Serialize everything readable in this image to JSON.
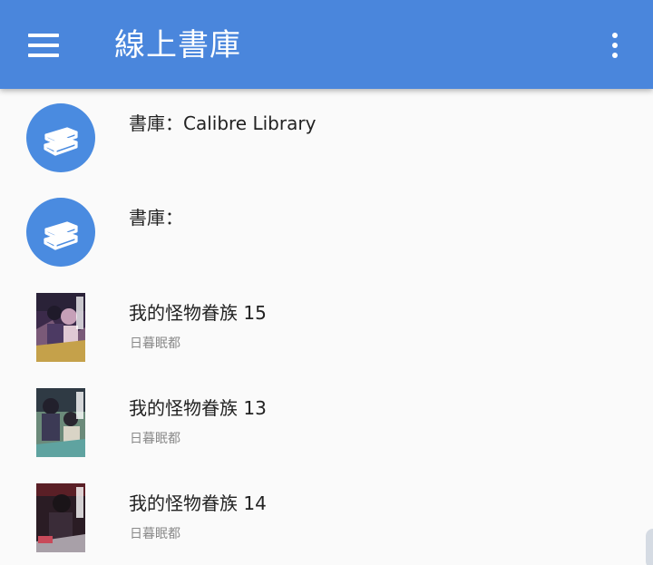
{
  "app_bar": {
    "title": "線上書庫",
    "menu_icon": "menu-icon",
    "more_icon": "more-vert-icon",
    "color": "#4a86dc"
  },
  "libraries": [
    {
      "label": "書庫：Calibre Library",
      "icon": "books-icon"
    },
    {
      "label": "書庫：",
      "icon": "books-icon"
    }
  ],
  "books": [
    {
      "title": "我的怪物眷族 15",
      "author": "日暮眠都"
    },
    {
      "title": "我的怪物眷族 13",
      "author": "日暮眠都"
    },
    {
      "title": "我的怪物眷族 14",
      "author": "日暮眠都"
    }
  ]
}
